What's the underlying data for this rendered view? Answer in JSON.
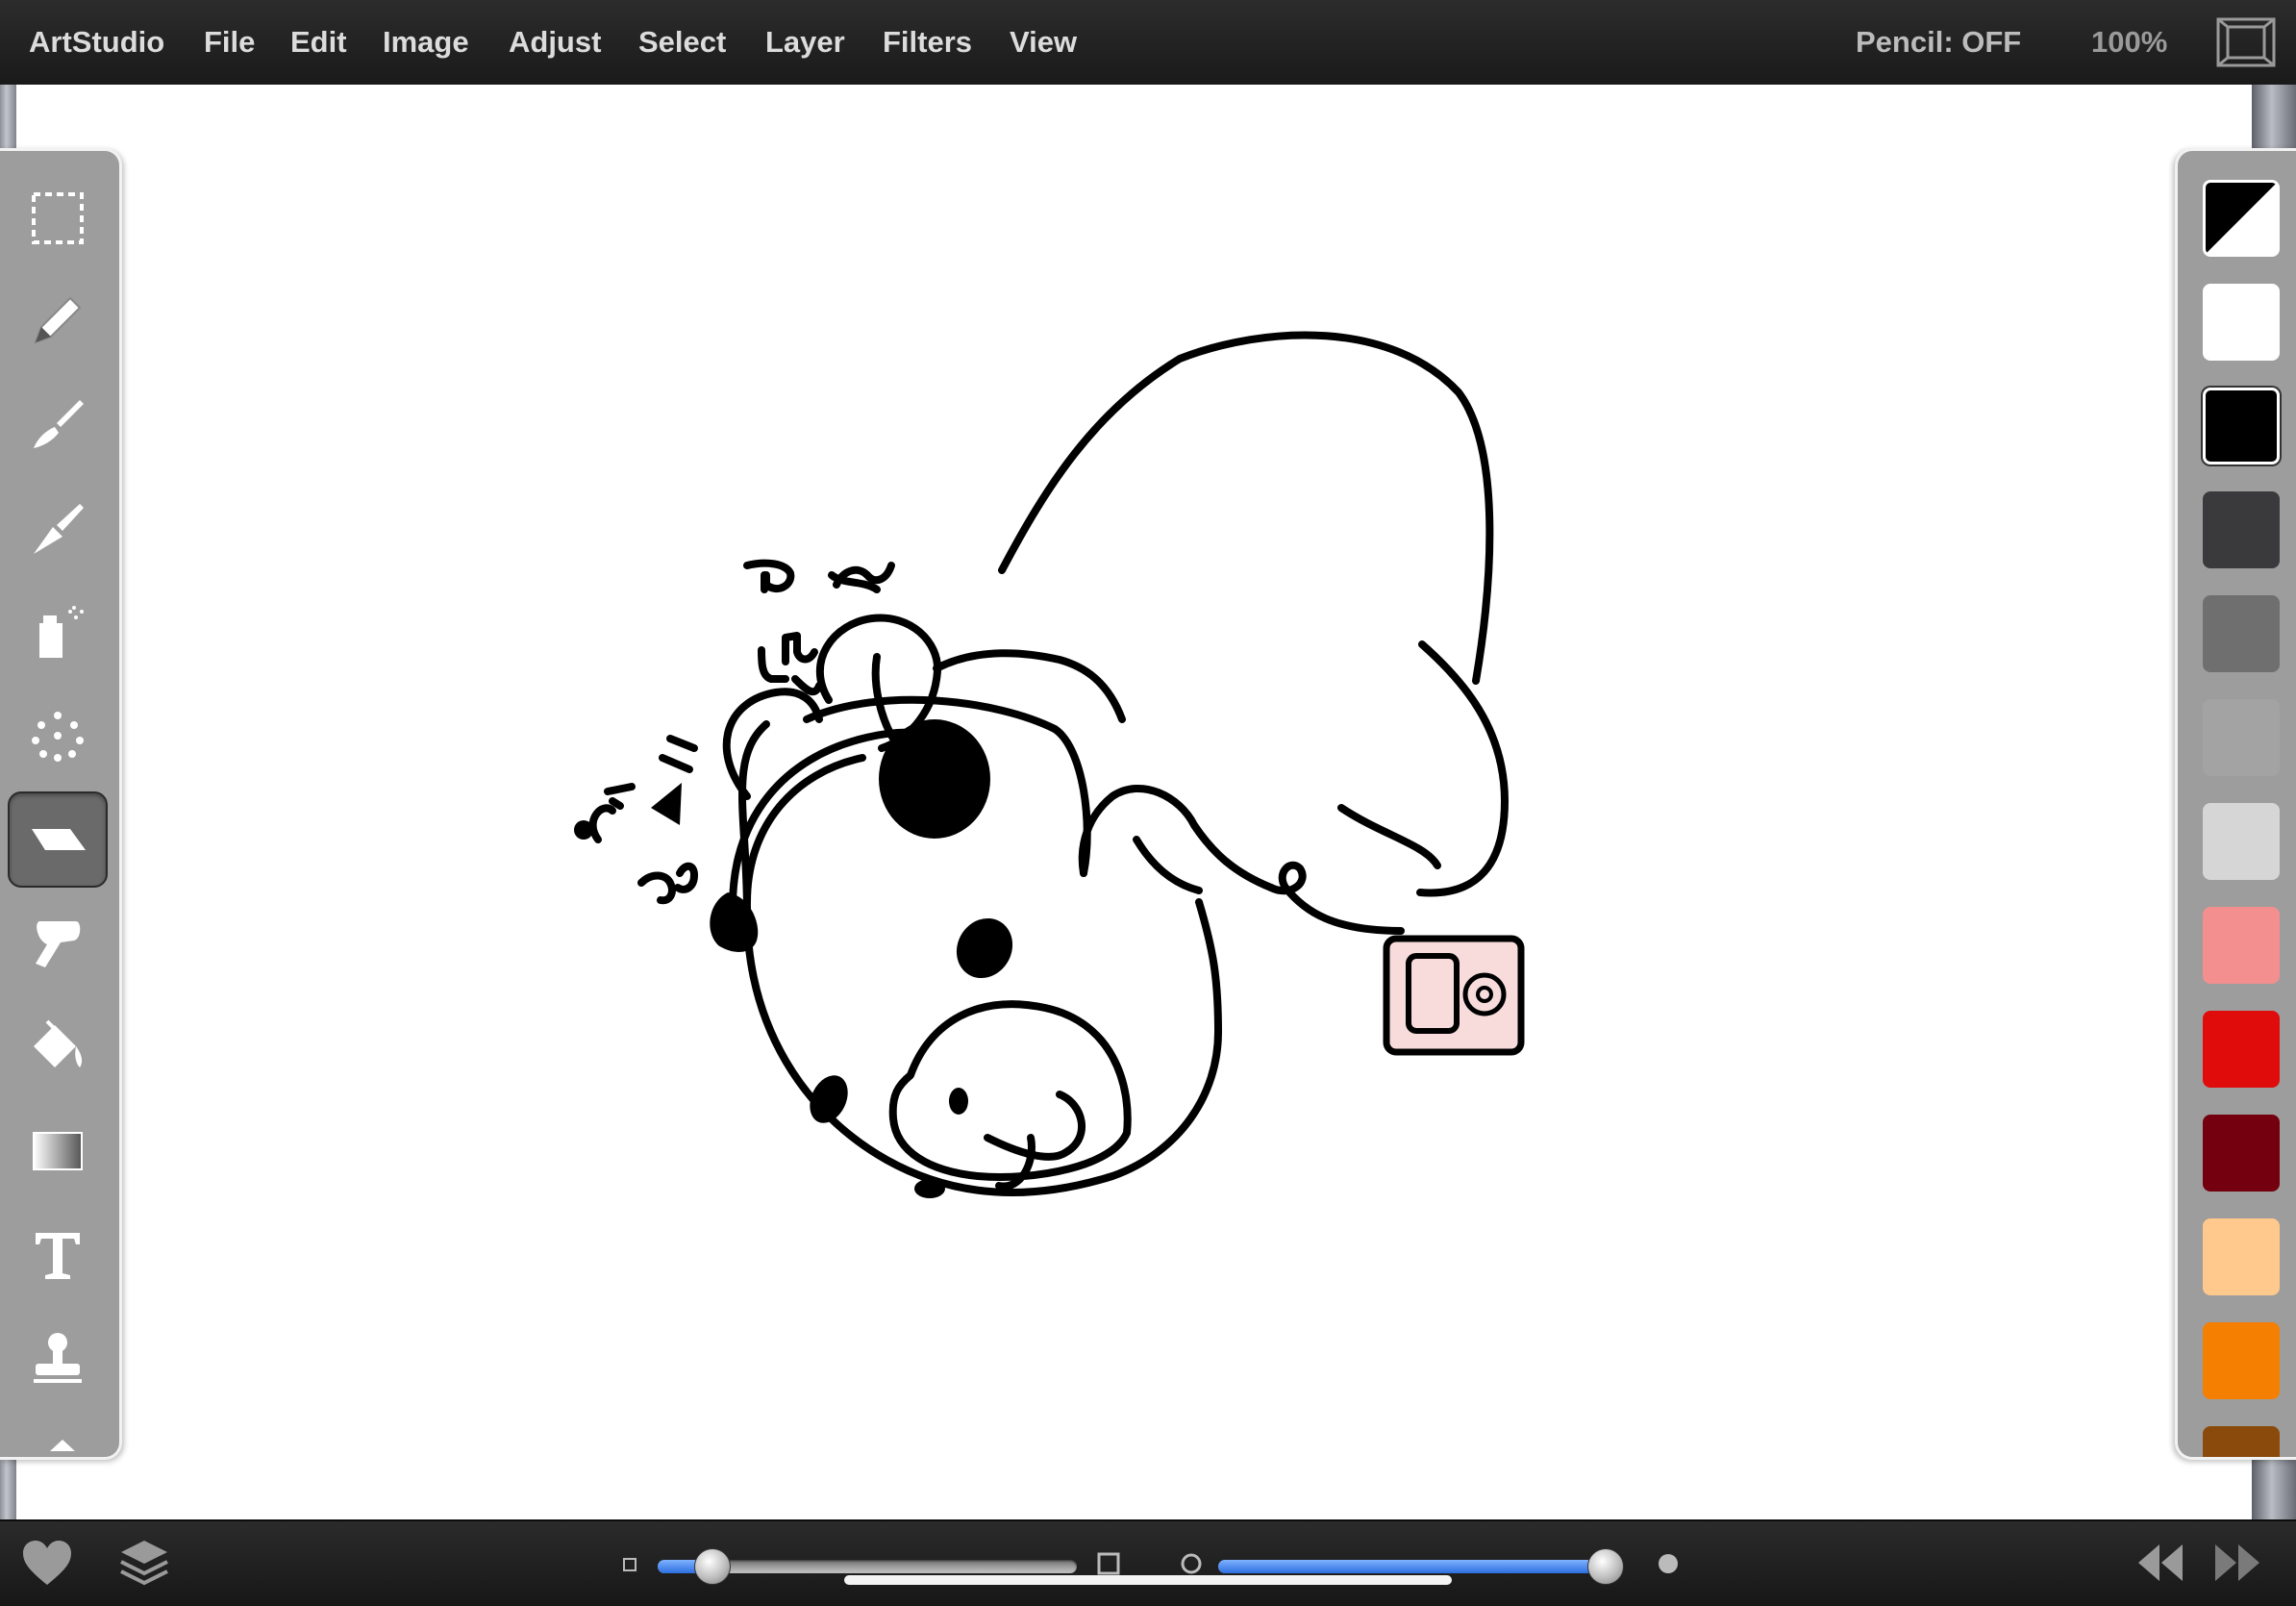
{
  "menu": {
    "app_name": "ArtStudio",
    "items": [
      "File",
      "Edit",
      "Image",
      "Adjust",
      "Select",
      "Layer",
      "Filters",
      "View"
    ]
  },
  "status": {
    "pencil": "Pencil: OFF",
    "zoom": "100%"
  },
  "tools": [
    {
      "name": "selection-tool",
      "icon": "marquee-icon",
      "active": false
    },
    {
      "name": "pencil-tool",
      "icon": "pencil-icon",
      "active": false
    },
    {
      "name": "brush-tool",
      "icon": "brush-icon",
      "active": false
    },
    {
      "name": "smudge-tool",
      "icon": "smudge-brush-icon",
      "active": false
    },
    {
      "name": "spray-tool",
      "icon": "spray-can-icon",
      "active": false
    },
    {
      "name": "dots-tool",
      "icon": "dots-icon",
      "active": false
    },
    {
      "name": "eraser-tool",
      "icon": "eraser-icon",
      "active": true
    },
    {
      "name": "finger-smudge-tool",
      "icon": "finger-icon",
      "active": false
    },
    {
      "name": "fill-tool",
      "icon": "paint-bucket-icon",
      "active": false
    },
    {
      "name": "gradient-tool",
      "icon": "gradient-icon",
      "active": false
    },
    {
      "name": "text-tool",
      "icon": "text-icon",
      "active": false
    },
    {
      "name": "stamp-tool",
      "icon": "stamp-icon",
      "active": false
    }
  ],
  "colors": {
    "primary_pair": [
      "#000000",
      "#ffffff"
    ],
    "swatches": [
      "#ffffff",
      "#000000",
      "#3a3a3c",
      "#6f6f6f",
      "#a3a3a3",
      "#d6d6d6",
      "#f38f8f",
      "#e00c0c",
      "#74000f",
      "#ffc98e",
      "#f57f00",
      "#8a4a0c"
    ],
    "selected_index": 1,
    "ipod_pink": "#f8dcdc",
    "accent_blue": "#2d6fe0"
  },
  "sliders": {
    "brush_size_fraction": 0.13,
    "opacity_fraction": 0.96
  }
}
